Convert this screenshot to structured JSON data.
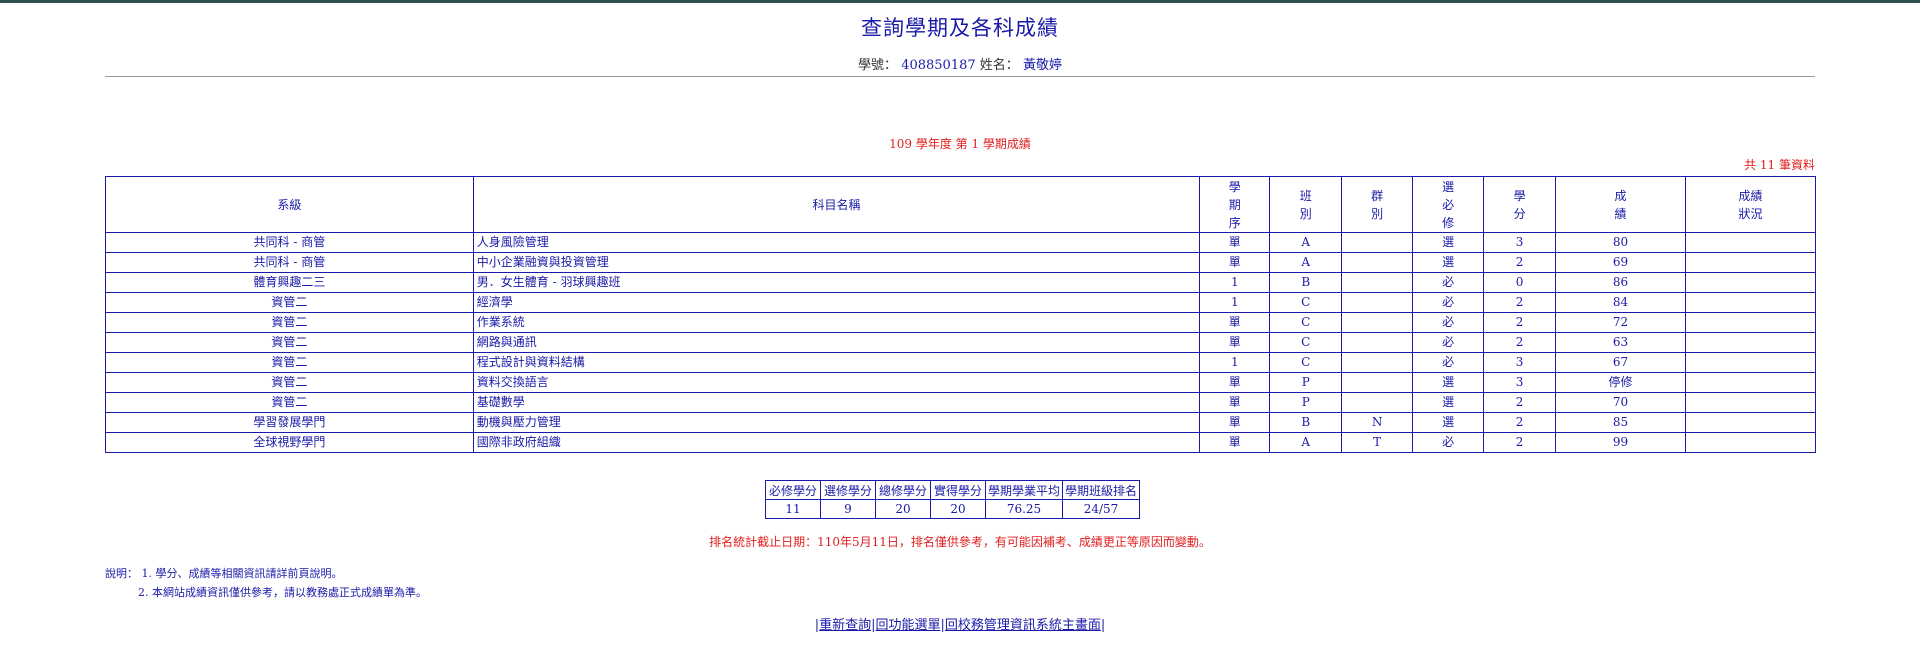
{
  "header": {
    "title": "查詢學期及各科成績",
    "student_id_label": "學號：",
    "student_id": "408850187",
    "name_label": "姓名：",
    "name": "黃敬婷"
  },
  "semester_caption": "109 學年度 第 1 學期成績",
  "record_count": "共 11 筆資料",
  "table": {
    "headers": [
      "系級",
      "科目名稱",
      "學期序",
      "班別",
      "群別",
      "選必修",
      "學分",
      "成績",
      "成績狀況"
    ],
    "rows": [
      [
        "共同科 - 商管",
        "人身風險管理",
        "單",
        "A",
        "",
        "選",
        "3",
        "80",
        ""
      ],
      [
        "共同科 - 商管",
        "中小企業融資與投資管理",
        "單",
        "A",
        "",
        "選",
        "2",
        "69",
        ""
      ],
      [
        "體育興趣二三",
        "男．女生體育 - 羽球興趣班",
        "1",
        "B",
        "",
        "必",
        "0",
        "86",
        ""
      ],
      [
        "資管二",
        "經濟學",
        "1",
        "C",
        "",
        "必",
        "2",
        "84",
        ""
      ],
      [
        "資管二",
        "作業系統",
        "單",
        "C",
        "",
        "必",
        "2",
        "72",
        ""
      ],
      [
        "資管二",
        "網路與通訊",
        "單",
        "C",
        "",
        "必",
        "2",
        "63",
        ""
      ],
      [
        "資管二",
        "程式設計與資料結構",
        "1",
        "C",
        "",
        "必",
        "3",
        "67",
        ""
      ],
      [
        "資管二",
        "資料交換語言",
        "單",
        "P",
        "",
        "選",
        "3",
        "停修",
        ""
      ],
      [
        "資管二",
        "基礎數學",
        "單",
        "P",
        "",
        "選",
        "2",
        "70",
        ""
      ],
      [
        "學習發展學門",
        "動機與壓力管理",
        "單",
        "B",
        "N",
        "選",
        "2",
        "85",
        ""
      ],
      [
        "全球視野學門",
        "國際非政府組織",
        "單",
        "A",
        "T",
        "必",
        "2",
        "99",
        ""
      ]
    ]
  },
  "summary": {
    "headers": [
      "必修學分",
      "選修學分",
      "總修學分",
      "實得學分",
      "學期學業平均",
      "學期班級排名"
    ],
    "values": [
      "11",
      "9",
      "20",
      "20",
      "76.25",
      "24/57"
    ]
  },
  "ranking_notice": "排名統計截止日期：110年5月11日，排名僅供參考，有可能因補考、成績更正等原因而變動。",
  "notes": {
    "label": "說明：",
    "items": [
      "1. 學分、成績等相關資訊請詳前頁說明。",
      "2. 本網站成績資訊僅供參考，請以教務處正式成績單為準。"
    ]
  },
  "links": [
    "重新查詢",
    "回功能選單",
    "回校務管理資訊系統主畫面"
  ]
}
